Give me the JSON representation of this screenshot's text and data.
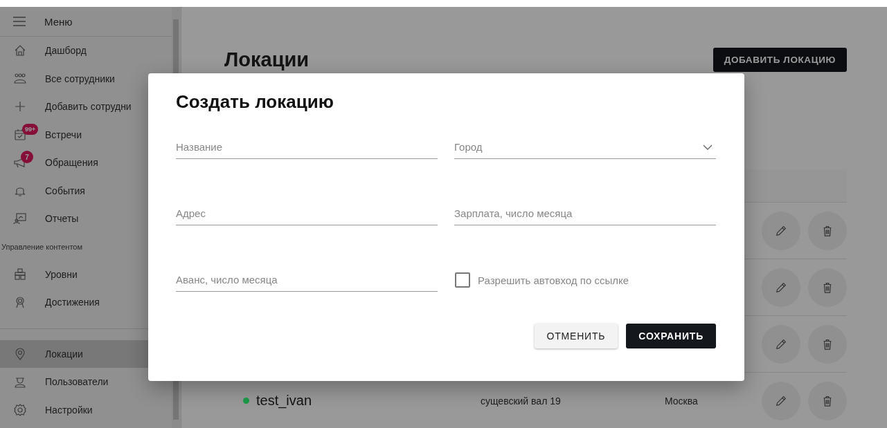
{
  "sidebar": {
    "title": "Меню",
    "items": [
      {
        "kind": "link",
        "label": "Дашборд",
        "selected": false
      },
      {
        "kind": "link",
        "label": "Все сотрудники",
        "selected": false
      },
      {
        "kind": "link",
        "label": "Добавить сотрудни",
        "selected": false
      },
      {
        "kind": "link",
        "label": "Встречи",
        "badge": "99+",
        "selected": false
      },
      {
        "kind": "link",
        "label": "Обращения",
        "badge": "7",
        "selected": false
      },
      {
        "kind": "link",
        "label": "События",
        "selected": false
      },
      {
        "kind": "link",
        "label": "Отчеты",
        "selected": false
      },
      {
        "kind": "heading",
        "label": "Управление контентом"
      },
      {
        "kind": "link",
        "label": "Уровни",
        "selected": false
      },
      {
        "kind": "link",
        "label": "Достижения",
        "selected": false
      },
      {
        "kind": "divider"
      },
      {
        "kind": "link",
        "label": "Локации",
        "selected": true
      },
      {
        "kind": "link",
        "label": "Пользователи",
        "selected": false
      },
      {
        "kind": "link",
        "label": "Настройки",
        "selected": false
      }
    ]
  },
  "page": {
    "title": "Локации",
    "add_button": "ДОБАВИТЬ ЛОКАЦИЮ"
  },
  "table": {
    "rows": [
      {
        "kind": "covered"
      },
      {
        "kind": "covered"
      },
      {
        "kind": "covered"
      },
      {
        "kind": "row",
        "name": "test_ivan",
        "color": "#1c9a48",
        "address": "сущевский вал 19",
        "city": "Москва"
      }
    ]
  },
  "dialog": {
    "title": "Создать локацию",
    "fields": [
      {
        "kind": "text",
        "placeholder": "Название"
      },
      {
        "kind": "select",
        "placeholder": "Город"
      },
      {
        "kind": "text",
        "placeholder": "Адрес"
      },
      {
        "kind": "text",
        "placeholder": "Зарплата, число месяца"
      },
      {
        "kind": "text",
        "placeholder": "Аванс, число месяца"
      },
      {
        "kind": "checkbox",
        "label": "Разрешить автовход по ссылке",
        "checked": false
      }
    ],
    "buttons": [
      {
        "kind": "secondary",
        "label": "ОТМЕНИТЬ"
      },
      {
        "kind": "primary",
        "label": "СОХРАНИТЬ"
      }
    ]
  }
}
